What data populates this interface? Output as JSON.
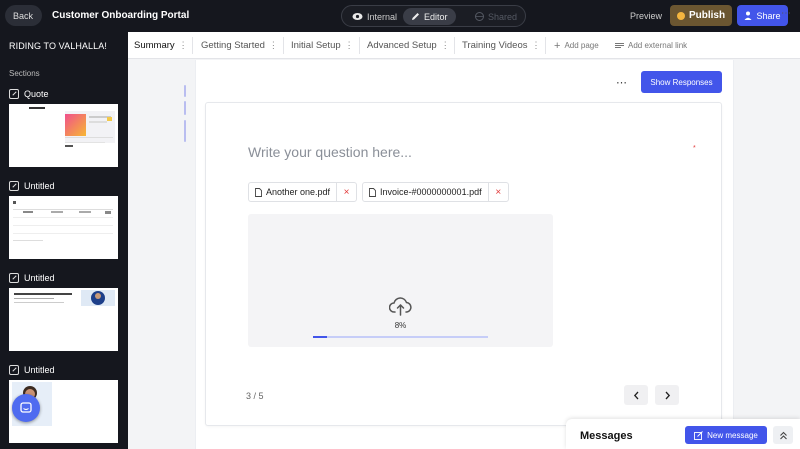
{
  "topbar": {
    "back_label": "Back",
    "title": "Customer Onboarding Portal",
    "modes": [
      {
        "label": "Internal",
        "icon": "eye-icon"
      },
      {
        "label": "Editor",
        "icon": "pencil-icon"
      },
      {
        "label": "Shared",
        "icon": "globe-icon"
      }
    ],
    "active_mode": "Editor",
    "preview_label": "Preview",
    "publish_label": "Publish",
    "share_label": "Share"
  },
  "sidebar": {
    "title": "RIDING TO VALHALLA!",
    "sections_label": "Sections",
    "items": [
      {
        "label": "Quote"
      },
      {
        "label": "Untitled"
      },
      {
        "label": "Untitled"
      },
      {
        "label": "Untitled"
      }
    ]
  },
  "tabs": {
    "items": [
      {
        "label": "Summary"
      },
      {
        "label": "Getting Started"
      },
      {
        "label": "Initial Setup"
      },
      {
        "label": "Advanced Setup"
      },
      {
        "label": "Training Videos"
      }
    ],
    "active": "Summary",
    "add_page_label": "Add page",
    "add_external_link_label": "Add external link"
  },
  "editor": {
    "show_responses_label": "Show Responses",
    "question_placeholder": "Write your question here...",
    "required_marker": "*",
    "files": [
      {
        "name": "Another one.pdf"
      },
      {
        "name": "Invoice-#0000000001.pdf"
      }
    ],
    "upload": {
      "percent_label": "8%",
      "progress": 0.08
    },
    "page_indicator": "3 / 5"
  },
  "messages": {
    "title": "Messages",
    "new_message_label": "New message"
  },
  "colors": {
    "accent": "#4255ea",
    "dark_bg": "#15171e",
    "publish_bg": "#6b5631",
    "danger": "#e23b3b"
  }
}
